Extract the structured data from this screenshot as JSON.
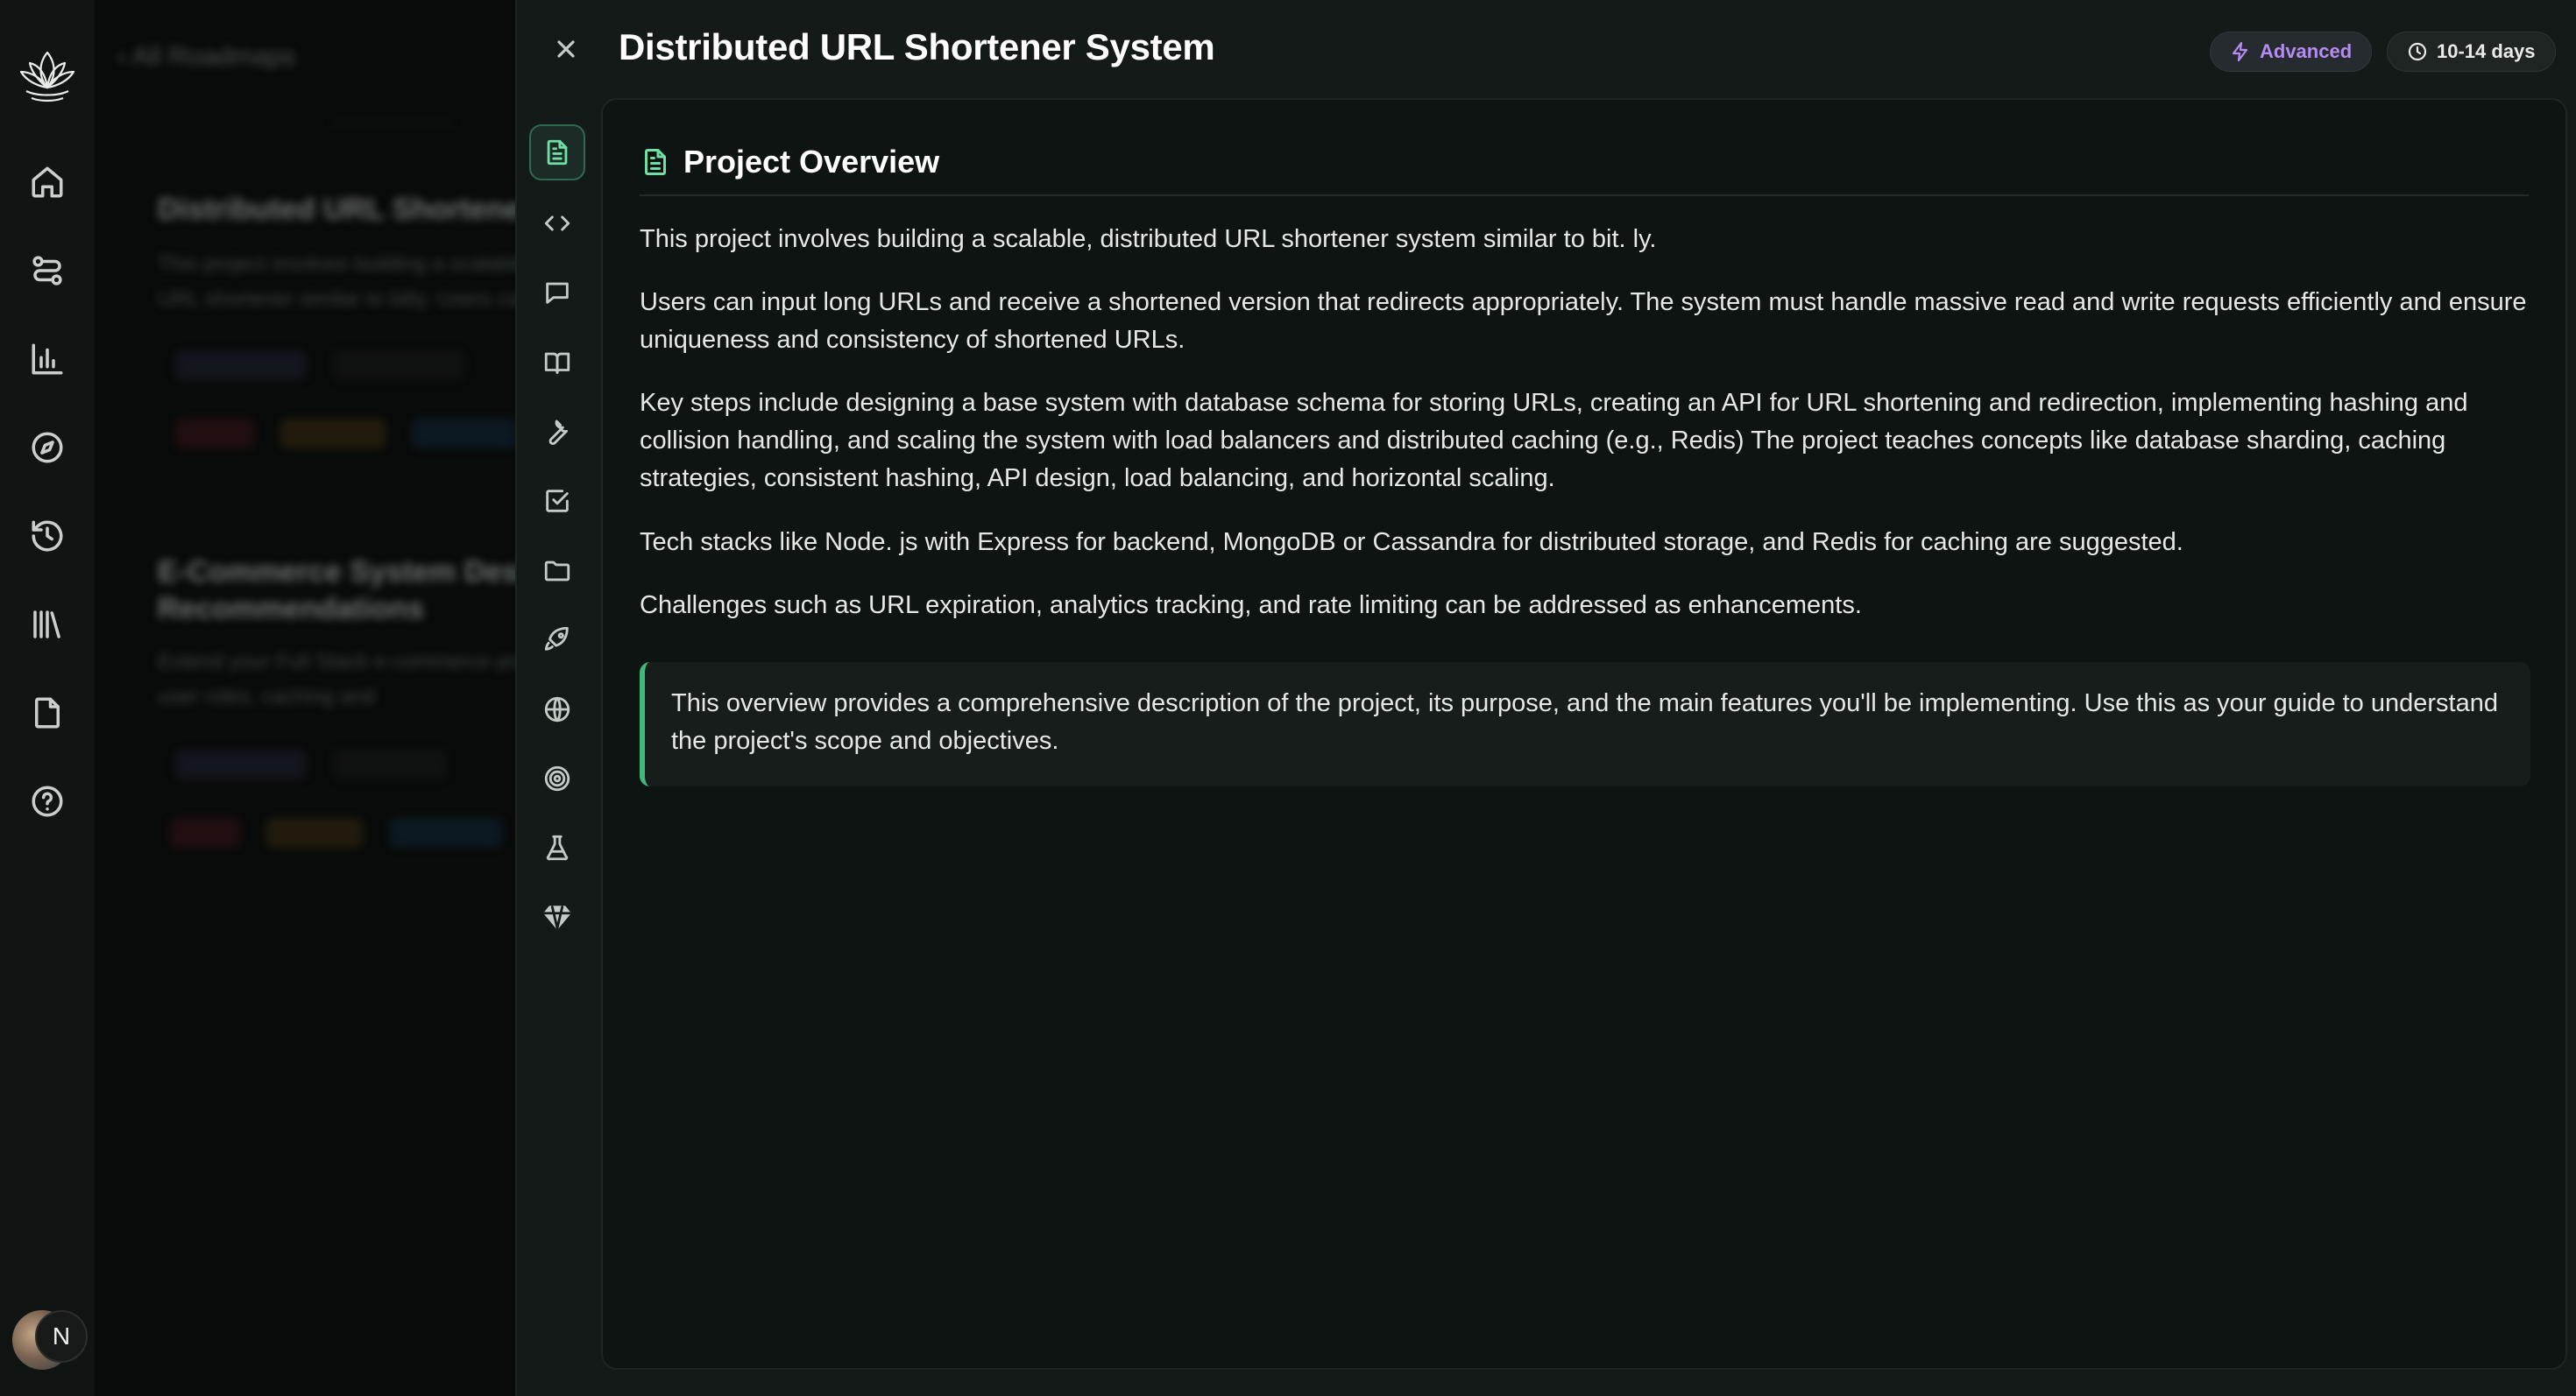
{
  "app": {
    "nav": [
      "home-icon",
      "roadmap-icon",
      "analytics-icon",
      "explore-icon",
      "history-icon",
      "library-icon",
      "document-icon",
      "help-icon"
    ],
    "avatar_initial": "N"
  },
  "background": {
    "back_label": "All Roadmaps",
    "cards": [
      {
        "title": "Distributed URL Shortener",
        "desc": "This project involves building a scalable, distributed URL shortener similar to bitly. Users can input"
      },
      {
        "title": "E-Commerce System Design Recommendations",
        "desc": "Extend your Full Stack e-commerce product listings, user roles, caching and"
      }
    ]
  },
  "drawer": {
    "title": "Distributed URL Shortener System",
    "badges": {
      "level": "Advanced",
      "duration": "10-14 days"
    },
    "sections": [
      "overview-icon",
      "code-icon",
      "chat-icon",
      "book-icon",
      "wrench-icon",
      "checklist-icon",
      "folder-icon",
      "rocket-icon",
      "globe-icon",
      "target-icon",
      "flask-icon",
      "gem-icon"
    ],
    "active_section": "overview",
    "overview": {
      "heading": "Project Overview",
      "paragraphs": [
        "This project involves building a scalable, distributed URL shortener system similar to bit. ly.",
        "Users can input long URLs and receive a shortened version that redirects appropriately. The system must handle massive read and write requests efficiently and ensure uniqueness and consistency of shortened URLs.",
        "Key steps include designing a base system with database schema for storing URLs, creating an API for URL shortening and redirection, implementing hashing and collision handling, and scaling the system with load balancers and distributed caching (e.g., Redis) The project teaches concepts like database sharding, caching strategies, consistent hashing, API design, load balancing, and horizontal scaling.",
        "Tech stacks like Node. js with Express for backend, MongoDB or Cassandra for distributed storage, and Redis for caching are suggested.",
        "Challenges such as URL expiration, analytics tracking, and rate limiting can be addressed as enhancements."
      ],
      "note": "This overview provides a comprehensive description of the project, its purpose, and the main features you'll be implementing. Use this as your guide to understand the project's scope and objectives."
    }
  },
  "colors": {
    "accent_green": "#6ee0a4",
    "advanced_purple": "#b68cf0",
    "panel_bg": "#0e1412"
  }
}
